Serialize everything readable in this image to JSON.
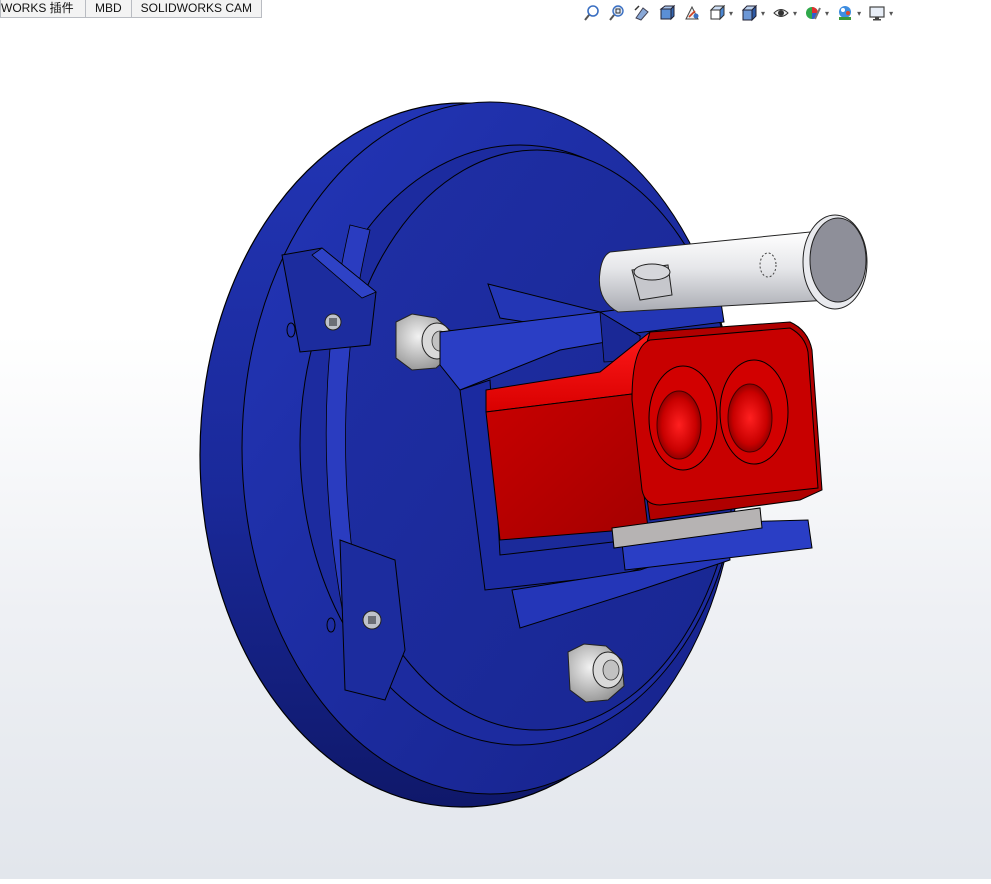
{
  "command_tabs": [
    {
      "label": "WORKS 插件"
    },
    {
      "label": "MBD"
    },
    {
      "label": "SOLIDWORKS CAM"
    }
  ],
  "heads_up_toolbar": [
    {
      "icon": "zoom-to-fit-icon"
    },
    {
      "icon": "zoom-to-area-icon"
    },
    {
      "icon": "previous-view-icon"
    },
    {
      "icon": "section-view-icon"
    },
    {
      "icon": "dynamic-annotation-views-icon"
    },
    {
      "icon": "view-orientation-icon"
    },
    {
      "icon": "display-style-icon"
    },
    {
      "icon": "hide-show-items-icon"
    },
    {
      "icon": "edit-appearance-icon"
    },
    {
      "icon": "apply-scene-icon"
    },
    {
      "icon": "view-settings-icon"
    }
  ],
  "colors": {
    "disc": "#1f2fa8",
    "disc_dark": "#14207a",
    "block_red": "#c40000",
    "pin": "#d9dbe0",
    "nut": "#c9c9c9"
  }
}
